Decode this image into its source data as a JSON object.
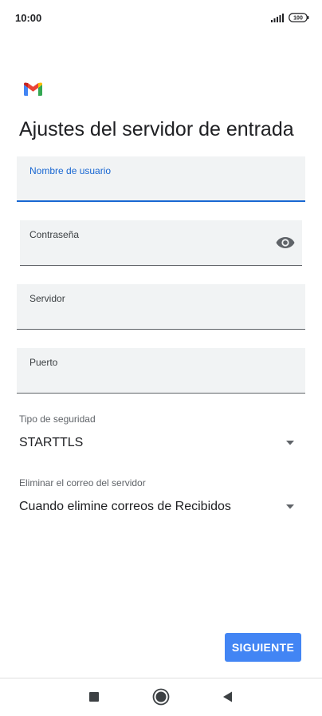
{
  "status_bar": {
    "time": "10:00",
    "battery": "100",
    "icons": [
      "signal-icon",
      "battery-icon"
    ]
  },
  "app": {
    "logo": "gmail-logo-icon",
    "title": "Ajustes del servidor de entrada"
  },
  "form": {
    "username": {
      "label": "Nombre de usuario",
      "value": "",
      "focused": true
    },
    "password": {
      "label": "Contraseña",
      "value": "",
      "toggle_icon": "eye-icon"
    },
    "server": {
      "label": "Servidor",
      "value": ""
    },
    "port": {
      "label": "Puerto",
      "value": ""
    },
    "security": {
      "label": "Tipo de seguridad",
      "value": "STARTTLS"
    },
    "delete_mail": {
      "label": "Eliminar el correo del servidor",
      "value": "Cuando elimine correos de Recibidos"
    }
  },
  "actions": {
    "next_label": "SIGUIENTE"
  },
  "nav_bar": {
    "buttons": [
      "recents-square-icon",
      "home-circle-icon",
      "back-triangle-icon"
    ]
  },
  "colors": {
    "accent": "#1967d2",
    "button": "#4285f4",
    "field_bg": "#f1f3f4",
    "text": "#202124"
  }
}
